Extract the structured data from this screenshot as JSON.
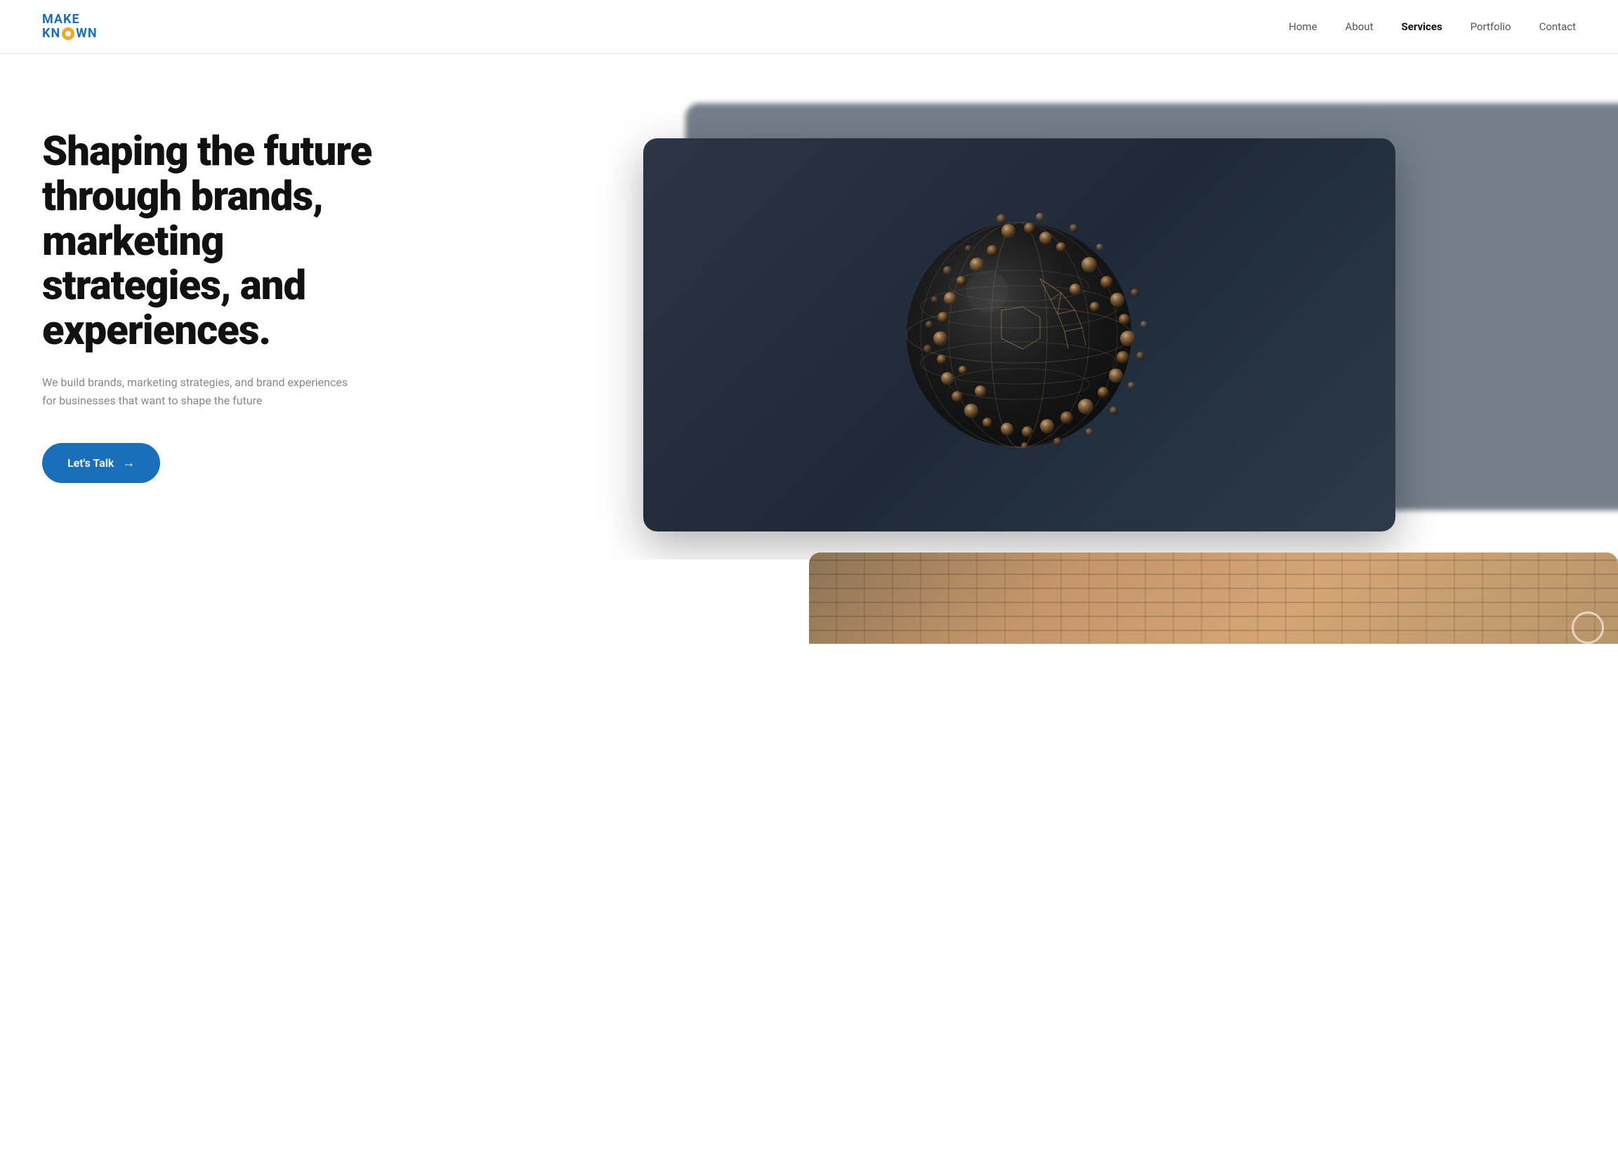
{
  "header": {
    "logo": {
      "make": "MAKE",
      "known_before": "KN",
      "known_after": "WN"
    },
    "nav": {
      "items": [
        {
          "label": "Home",
          "active": false
        },
        {
          "label": "About",
          "active": false
        },
        {
          "label": "Services",
          "active": true
        },
        {
          "label": "Portfolio",
          "active": false
        },
        {
          "label": "Contact",
          "active": false
        }
      ]
    }
  },
  "hero": {
    "title": "Shaping the future through brands, marketing strategies, and experiences.",
    "subtitle": "We build brands, marketing strategies, and brand experiences for businesses that want to shape the future",
    "cta_label": "Let's Talk",
    "cta_arrow": "→"
  },
  "colors": {
    "brand_blue": "#1a6fba",
    "brand_orange": "#f5a623",
    "nav_active": "#111111",
    "nav_inactive": "#555555",
    "hero_title": "#111111",
    "hero_subtitle": "#888888",
    "card_bg": "#2a3545"
  }
}
